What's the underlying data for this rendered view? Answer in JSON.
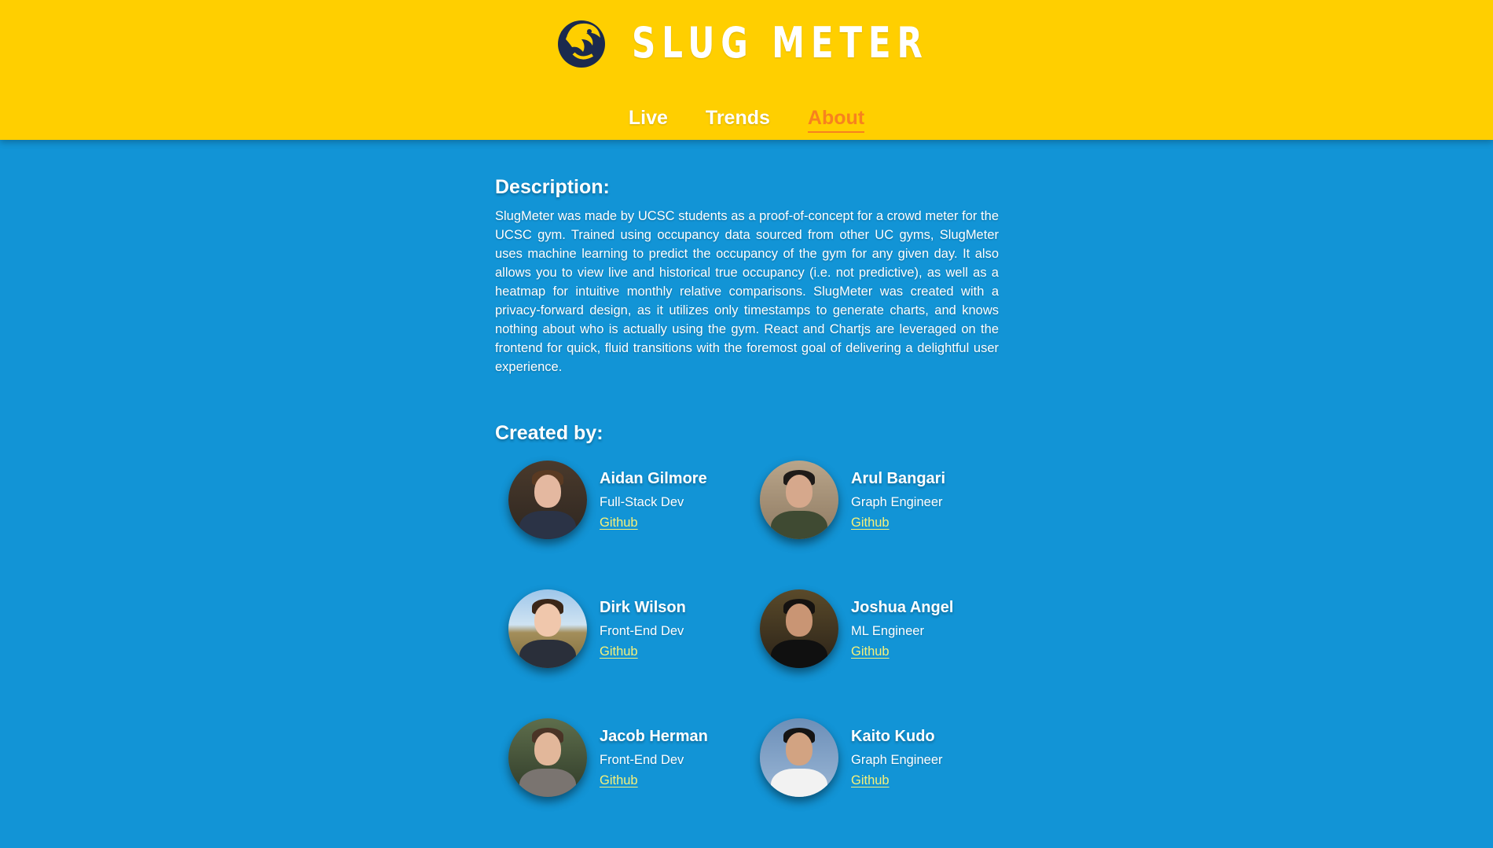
{
  "header": {
    "brand": "SLUG METER",
    "logo_icon": "slug-mascot-icon",
    "nav": [
      {
        "label": "Live",
        "active": false
      },
      {
        "label": "Trends",
        "active": false
      },
      {
        "label": "About",
        "active": true
      }
    ]
  },
  "description": {
    "title": "Description:",
    "text": "SlugMeter was made by UCSC students as a proof-of-concept for a crowd meter for the UCSC gym. Trained using occupancy data sourced from other UC gyms, SlugMeter uses machine learning to predict the occupancy of the gym for any given day. It also allows you to view live and historical true occupancy (i.e. not predictive), as well as a heatmap for intuitive monthly relative comparisons. SlugMeter was created with a privacy-forward design, as it utilizes only timestamps to generate charts, and knows nothing about who is actually using the gym. React and Chartjs are leveraged on the frontend for quick, fluid transitions with the foremost goal of delivering a delightful user experience."
  },
  "team": {
    "title": "Created by:",
    "members": [
      {
        "name": "Aidan Gilmore",
        "role": "Full-Stack Dev",
        "link": "Github"
      },
      {
        "name": "Arul Bangari",
        "role": "Graph Engineer",
        "link": "Github"
      },
      {
        "name": "Dirk Wilson",
        "role": "Front-End Dev",
        "link": "Github"
      },
      {
        "name": "Joshua Angel",
        "role": "ML Engineer",
        "link": "Github"
      },
      {
        "name": "Jacob Herman",
        "role": "Front-End Dev",
        "link": "Github"
      },
      {
        "name": "Kaito Kudo",
        "role": "Graph Engineer",
        "link": "Github"
      }
    ]
  },
  "colors": {
    "header_bg": "#ffcf00",
    "page_bg": "#1294d6",
    "active_nav": "#f7821e",
    "link": "#f5f07a"
  }
}
